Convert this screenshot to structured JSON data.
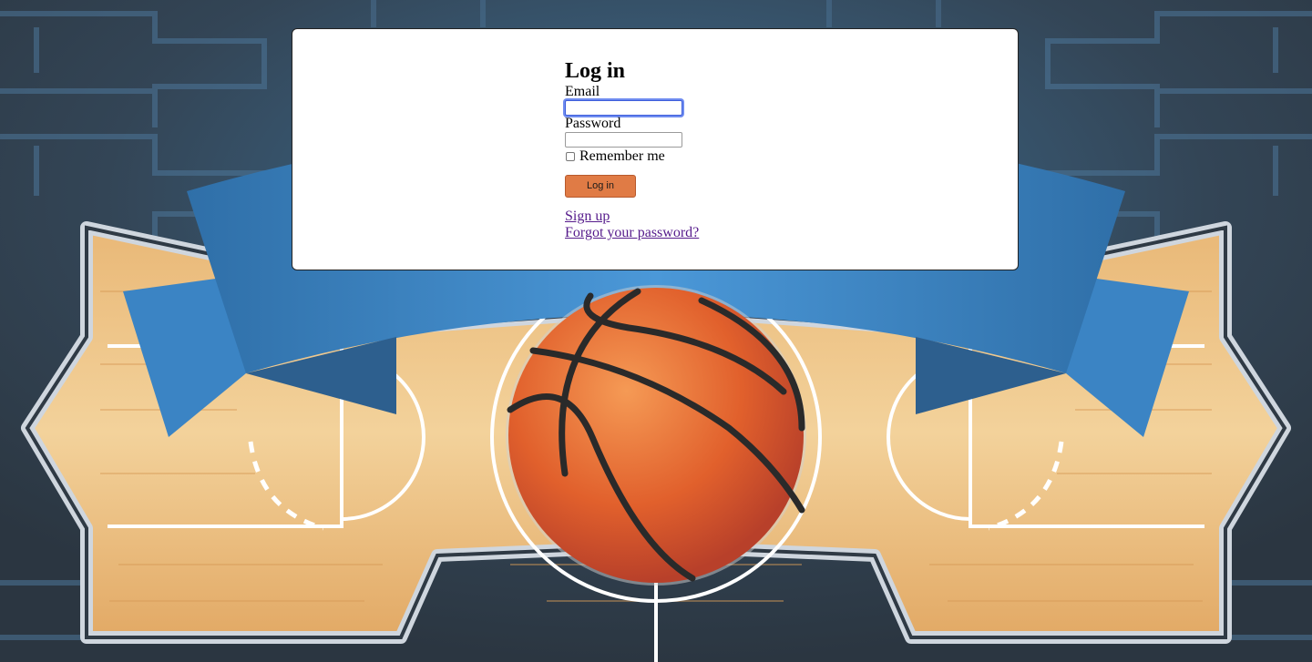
{
  "login": {
    "title": "Log in",
    "email_label": "Email",
    "email_value": "",
    "password_label": "Password",
    "password_value": "",
    "remember_label": "Remember me",
    "remember_checked": false,
    "submit_label": "Log in",
    "signup_link": "Sign up",
    "forgot_link": "Forgot your password?"
  },
  "colors": {
    "button_bg": "#e07b45",
    "link": "#551a8b",
    "focus_ring": "#6f8cf0",
    "ribbon": "#3b84c4",
    "ball": "#e8733a"
  },
  "background": {
    "icons": [
      "tournament-bracket",
      "basketball-court",
      "blue-ribbon-banner",
      "basketball"
    ]
  }
}
